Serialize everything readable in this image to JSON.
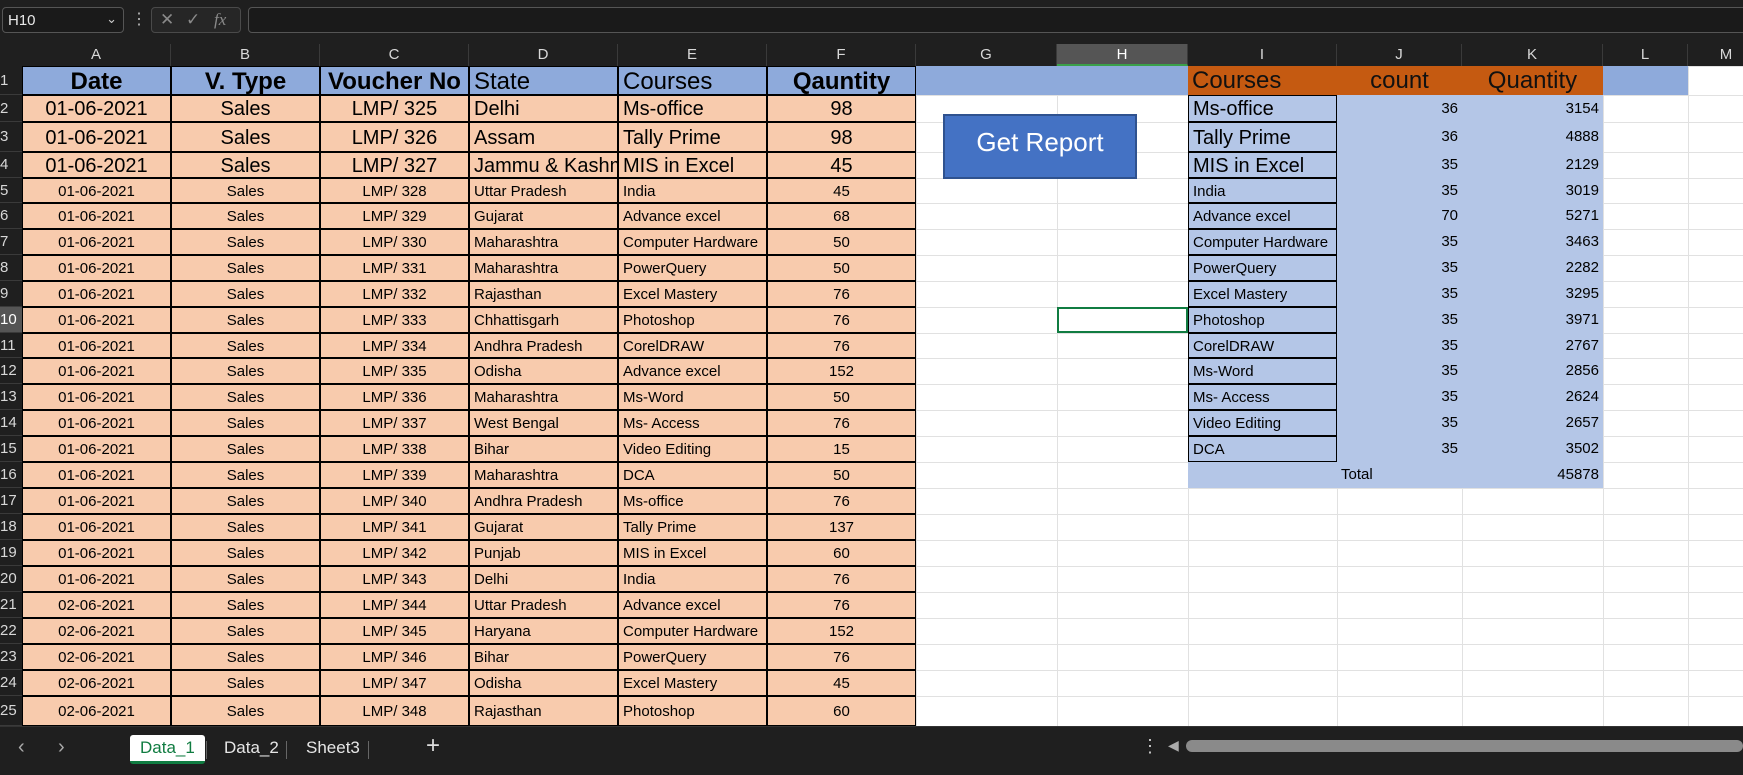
{
  "formula_bar": {
    "name_box": "H10",
    "fx": "fx",
    "formula": ""
  },
  "columns": [
    "A",
    "B",
    "C",
    "D",
    "E",
    "F",
    "G",
    "H",
    "I",
    "J",
    "K",
    "L",
    "M"
  ],
  "rows": [
    "1",
    "2",
    "3",
    "4",
    "5",
    "6",
    "7",
    "8",
    "9",
    "10",
    "11",
    "12",
    "13",
    "14",
    "15",
    "16",
    "17",
    "18",
    "19",
    "20",
    "21",
    "22",
    "23",
    "24",
    "25"
  ],
  "selected_cell": {
    "col": "H",
    "row": "10"
  },
  "table": {
    "headers": [
      "Date",
      "V. Type",
      "Voucher No",
      "State",
      "Courses",
      "Qauntity"
    ],
    "rows": [
      [
        "01-06-2021",
        "Sales",
        "LMP/   325",
        "Delhi",
        "Ms-office",
        "98"
      ],
      [
        "01-06-2021",
        "Sales",
        "LMP/   326",
        "Assam",
        "Tally Prime",
        "98"
      ],
      [
        "01-06-2021",
        "Sales",
        "LMP/   327",
        "Jammu &  Kashmir",
        "MIS in Excel",
        "45"
      ],
      [
        "01-06-2021",
        "Sales",
        "LMP/   328",
        "Uttar Pradesh",
        "India",
        "45"
      ],
      [
        "01-06-2021",
        "Sales",
        "LMP/   329",
        "Gujarat",
        "Advance excel",
        "68"
      ],
      [
        "01-06-2021",
        "Sales",
        "LMP/   330",
        " Maharashtra",
        "Computer Hardware",
        "50"
      ],
      [
        "01-06-2021",
        "Sales",
        "LMP/   331",
        " Maharashtra",
        "PowerQuery",
        "50"
      ],
      [
        "01-06-2021",
        "Sales",
        "LMP/   332",
        "Rajasthan",
        "Excel Mastery",
        "76"
      ],
      [
        "01-06-2021",
        "Sales",
        "LMP/   333",
        "Chhattisgarh",
        "Photoshop",
        "76"
      ],
      [
        "01-06-2021",
        "Sales",
        "LMP/   334",
        "Andhra Pradesh",
        "CorelDRAW",
        "76"
      ],
      [
        "01-06-2021",
        "Sales",
        "LMP/   335",
        "Odisha",
        "Advance excel",
        "152"
      ],
      [
        "01-06-2021",
        "Sales",
        "LMP/   336",
        " Maharashtra",
        "Ms-Word",
        "50"
      ],
      [
        "01-06-2021",
        "Sales",
        "LMP/   337",
        "West Bengal",
        "Ms- Access",
        "76"
      ],
      [
        "01-06-2021",
        "Sales",
        "LMP/   338",
        "Bihar",
        "Video Editing",
        "15"
      ],
      [
        "01-06-2021",
        "Sales",
        "LMP/   339",
        " Maharashtra",
        "DCA",
        "50"
      ],
      [
        "01-06-2021",
        "Sales",
        "LMP/   340",
        "Andhra Pradesh",
        "Ms-office",
        "76"
      ],
      [
        "01-06-2021",
        "Sales",
        "LMP/   341",
        "Gujarat",
        "Tally Prime",
        "137"
      ],
      [
        "01-06-2021",
        "Sales",
        "LMP/   342",
        "Punjab",
        "MIS in Excel",
        "60"
      ],
      [
        "01-06-2021",
        "Sales",
        "LMP/   343",
        "Delhi",
        "India",
        "76"
      ],
      [
        "02-06-2021",
        "Sales",
        "LMP/   344",
        "Uttar Pradesh",
        "Advance excel",
        "76"
      ],
      [
        "02-06-2021",
        "Sales",
        "LMP/   345",
        "Haryana",
        "Computer Hardware",
        "152"
      ],
      [
        "02-06-2021",
        "Sales",
        "LMP/   346",
        "Bihar",
        "PowerQuery",
        "76"
      ],
      [
        "02-06-2021",
        "Sales",
        "LMP/   347",
        "Odisha",
        "Excel Mastery",
        "45"
      ],
      [
        "02-06-2021",
        "Sales",
        "LMP/   348",
        "Rajasthan",
        "Photoshop",
        "60"
      ]
    ]
  },
  "button": {
    "label": "Get Report"
  },
  "report": {
    "headers": [
      "Courses",
      "count",
      "Quantity"
    ],
    "rows": [
      [
        "Ms-office",
        "36",
        "3154"
      ],
      [
        "Tally Prime",
        "36",
        "4888"
      ],
      [
        "MIS in Excel",
        "35",
        "2129"
      ],
      [
        "India",
        "35",
        "3019"
      ],
      [
        "Advance excel",
        "70",
        "5271"
      ],
      [
        "Computer Hardware",
        "35",
        "3463"
      ],
      [
        "PowerQuery",
        "35",
        "2282"
      ],
      [
        "Excel Mastery",
        "35",
        "3295"
      ],
      [
        "Photoshop",
        "35",
        "3971"
      ],
      [
        "CorelDRAW",
        "35",
        "2767"
      ],
      [
        "Ms-Word",
        "35",
        "2856"
      ],
      [
        "Ms- Access",
        "35",
        "2624"
      ],
      [
        "Video Editing",
        "35",
        "2657"
      ],
      [
        "DCA",
        "35",
        "3502"
      ]
    ],
    "total_label": "Total",
    "total_value": "45878"
  },
  "tabs": [
    "Data_1",
    "Data_2",
    "Sheet3"
  ],
  "active_tab": "Data_1",
  "colors": {
    "header_blue": "#8eaadb",
    "data_peach": "#f8cbad",
    "report_orange": "#c55a11",
    "report_blue": "#b4c6e7",
    "button_blue": "#4472c4",
    "accent_green": "#107c41"
  }
}
